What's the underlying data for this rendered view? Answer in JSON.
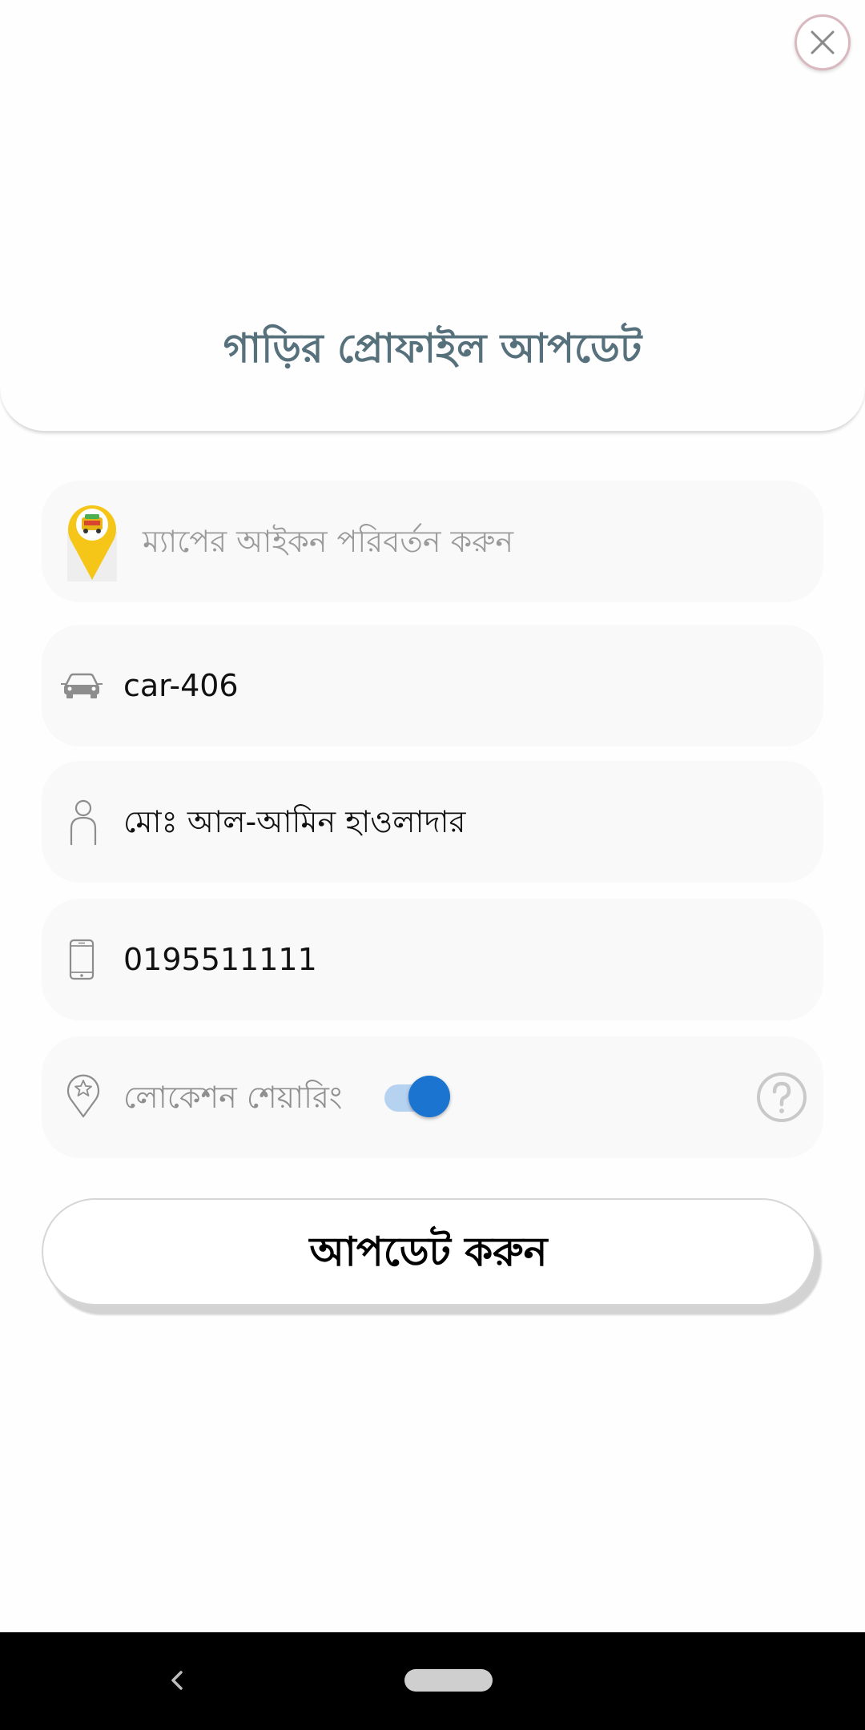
{
  "header": {
    "title": "গাড়ির প্রোফাইল আপডেট"
  },
  "form": {
    "map_icon_hint": "ম্যাপের আইকন পরিবর্তন করুন",
    "car_name": "car-406",
    "owner_name": "মোঃ আল-আমিন হাওলাদার",
    "phone": "0195511111",
    "location_sharing_label": "লোকেশন শেয়ারিং",
    "location_sharing_enabled": true
  },
  "actions": {
    "update_label": "আপডেট করুন"
  },
  "colors": {
    "title": "#56707c",
    "toggle_thumb": "#1b75d0",
    "toggle_track": "#b6d2f1",
    "marker": "#f5c518",
    "field_bg": "#f9f9f9"
  },
  "icons": {
    "close": "close-icon",
    "map_marker": "taxi-marker-icon",
    "car": "car-icon",
    "person": "person-icon",
    "phone": "phone-icon",
    "location": "location-pin-icon",
    "help": "help-icon"
  }
}
